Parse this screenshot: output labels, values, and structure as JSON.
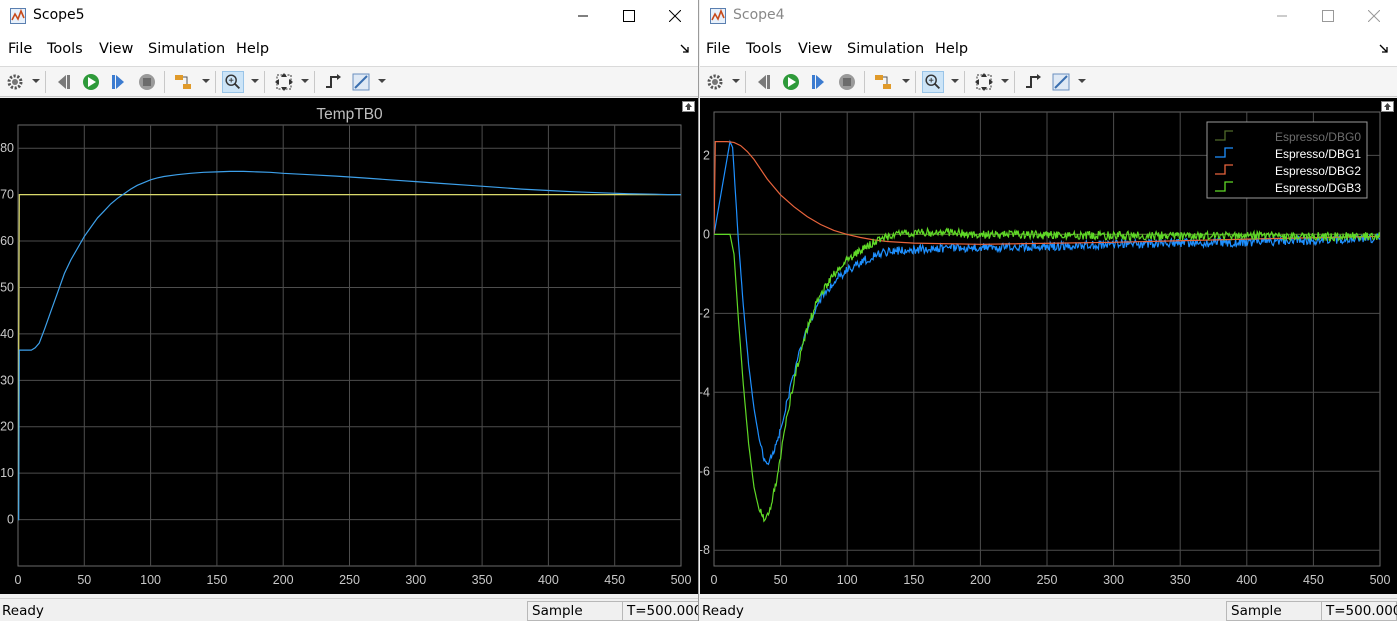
{
  "scope_left": {
    "window_title": "Scope5",
    "menu": [
      "File",
      "Tools",
      "View",
      "Simulation",
      "Help"
    ],
    "status": {
      "ready": "Ready",
      "mode": "Sample based",
      "time": "T=500.000"
    },
    "chart_data": {
      "type": "line",
      "title": "TempTB0",
      "xlim": [
        0,
        500
      ],
      "ylim": [
        -10,
        85
      ],
      "xticks": [
        0,
        50,
        100,
        150,
        200,
        250,
        300,
        350,
        400,
        450,
        500
      ],
      "yticks": [
        0,
        10,
        20,
        30,
        40,
        50,
        60,
        70,
        80
      ],
      "grid": true,
      "colors": {
        "background": "#000000",
        "grid": "#4d4d4d",
        "tick": "#c8c8c8",
        "title": "#bfbfbf"
      },
      "series": [
        {
          "color": "#d9d96a",
          "x": [
            0,
            0.1,
            1,
            2,
            500
          ],
          "y": [
            0,
            0,
            70,
            70,
            70
          ]
        },
        {
          "color": "#3da0ea",
          "x": [
            0,
            0.5,
            1,
            5,
            10,
            13,
            16,
            20,
            25,
            30,
            35,
            40,
            45,
            50,
            55,
            60,
            65,
            70,
            75,
            80,
            85,
            90,
            95,
            100,
            105,
            110,
            120,
            130,
            140,
            150,
            160,
            170,
            180,
            190,
            200,
            220,
            240,
            260,
            280,
            300,
            320,
            340,
            360,
            380,
            400,
            420,
            440,
            460,
            480,
            490,
            500
          ],
          "y": [
            0,
            0,
            36.5,
            36.5,
            36.5,
            37,
            38,
            41,
            45,
            49,
            53,
            56,
            58.5,
            61,
            63,
            65,
            66.5,
            68,
            69.2,
            70.2,
            71.2,
            72,
            72.6,
            73.2,
            73.6,
            73.9,
            74.3,
            74.6,
            74.8,
            74.9,
            75,
            75,
            74.9,
            74.8,
            74.6,
            74.3,
            74,
            73.6,
            73.2,
            72.8,
            72.4,
            72,
            71.6,
            71.2,
            70.9,
            70.6,
            70.4,
            70.2,
            70.1,
            70,
            70
          ]
        }
      ]
    }
  },
  "scope_right": {
    "window_title": "Scope4",
    "menu": [
      "File",
      "Tools",
      "View",
      "Simulation",
      "Help"
    ],
    "status": {
      "ready": "Ready",
      "mode": "Sample based",
      "time": "T=500.000"
    },
    "chart_data": {
      "type": "line",
      "title": "",
      "xlim": [
        0,
        500
      ],
      "ylim": [
        -8.4,
        3.1
      ],
      "xticks": [
        0,
        50,
        100,
        150,
        200,
        250,
        300,
        350,
        400,
        450,
        500
      ],
      "yticks": [
        -8,
        -6,
        -4,
        -2,
        0,
        2
      ],
      "grid": true,
      "legend_position": "top-right",
      "colors": {
        "background": "#000000",
        "grid": "#4d4d4d",
        "tick": "#c8c8c8"
      },
      "series": [
        {
          "name": "Espresso/DBG0",
          "color": "#4f6a2a",
          "legend_text_color": "#6e6e6e",
          "x": [
            0,
            500
          ],
          "y": [
            0,
            0
          ]
        },
        {
          "name": "Espresso/DBG1",
          "color": "#1e90ff",
          "legend_text_color": "#ffffff",
          "x": [
            0,
            12,
            14,
            18,
            22,
            26,
            30,
            34,
            38,
            42,
            46,
            50,
            55,
            60,
            65,
            70,
            75,
            80,
            90,
            100,
            110,
            120,
            130,
            140,
            150,
            170,
            200,
            250,
            300,
            350,
            400,
            450,
            500
          ],
          "y": [
            0,
            2.35,
            2.2,
            0,
            -1.8,
            -3.3,
            -4.4,
            -5.2,
            -5.7,
            -5.75,
            -5.4,
            -4.9,
            -4.2,
            -3.5,
            -2.9,
            -2.4,
            -2.0,
            -1.65,
            -1.2,
            -0.9,
            -0.7,
            -0.55,
            -0.45,
            -0.4,
            -0.38,
            -0.35,
            -0.33,
            -0.3,
            -0.25,
            -0.22,
            -0.2,
            -0.15,
            -0.1
          ]
        },
        {
          "name": "Espresso/DBG2",
          "color": "#e8643c",
          "legend_text_color": "#ffffff",
          "x": [
            0,
            1,
            10,
            15,
            20,
            25,
            30,
            35,
            40,
            45,
            50,
            60,
            70,
            80,
            90,
            100,
            110,
            120,
            130,
            150,
            200,
            300,
            400,
            500
          ],
          "y": [
            0,
            2.35,
            2.35,
            2.33,
            2.25,
            2.1,
            1.9,
            1.65,
            1.4,
            1.2,
            1.0,
            0.7,
            0.45,
            0.25,
            0.1,
            0.0,
            -0.08,
            -0.14,
            -0.18,
            -0.22,
            -0.25,
            -0.2,
            -0.12,
            -0.05
          ]
        },
        {
          "name": "Espresso/DGB3",
          "color": "#5fd926",
          "legend_text_color": "#ffffff",
          "x": [
            0,
            12,
            15,
            18,
            22,
            26,
            30,
            34,
            38,
            42,
            46,
            50,
            55,
            60,
            65,
            70,
            75,
            80,
            90,
            100,
            110,
            120,
            130,
            140,
            150,
            170,
            200,
            250,
            300,
            350,
            400,
            450,
            500
          ],
          "y": [
            0,
            0,
            -0.5,
            -2.0,
            -3.8,
            -5.3,
            -6.4,
            -7.0,
            -7.2,
            -7.0,
            -6.4,
            -5.6,
            -4.6,
            -3.7,
            -3.0,
            -2.4,
            -1.9,
            -1.5,
            -1.0,
            -0.65,
            -0.4,
            -0.2,
            -0.05,
            0.0,
            0.05,
            0.05,
            0.0,
            -0.02,
            -0.03,
            -0.04,
            -0.04,
            -0.05,
            -0.05
          ]
        }
      ]
    }
  }
}
